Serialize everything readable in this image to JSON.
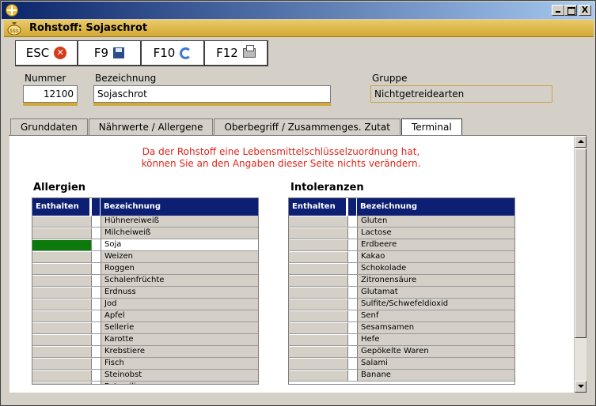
{
  "window": {
    "controls": {
      "minimize": "_",
      "maximize": "□",
      "close": "X"
    }
  },
  "header": {
    "title": "Rohstoff: Sojaschrot",
    "icon": "money-bag-icon"
  },
  "toolbar": [
    {
      "key": "ESC",
      "icon": "cancel-icon",
      "glyph": "✕"
    },
    {
      "key": "F9",
      "icon": "save-disk-icon"
    },
    {
      "key": "F10",
      "icon": "refresh-icon"
    },
    {
      "key": "F12",
      "icon": "printer-icon"
    }
  ],
  "fields": {
    "nummer": {
      "label": "Nummer",
      "value": "12100"
    },
    "bezeichnung": {
      "label": "Bezeichnung",
      "value": "Sojaschrot"
    },
    "gruppe": {
      "label": "Gruppe",
      "value": "Nichtgetreidearten"
    }
  },
  "tabs": [
    {
      "label": "Grunddaten",
      "active": false
    },
    {
      "label": "Nährwerte / Allergene",
      "active": false
    },
    {
      "label": "Oberbegriff / Zusammenges. Zutat",
      "active": false
    },
    {
      "label": "Terminal",
      "active": true
    }
  ],
  "notice": {
    "line1": "Da der Rohstoff eine Lebensmittelschlüsselzuordnung hat,",
    "line2": "können Sie an den Angaben dieser Seite nichts verändern."
  },
  "allergies": {
    "title": "Allergien",
    "col_contained": "Enthalten",
    "col_name": "Bezeichnung",
    "rows": [
      {
        "name": "Hühnereiweiß",
        "contained": false
      },
      {
        "name": "Milcheiweiß",
        "contained": false
      },
      {
        "name": "Soja",
        "contained": true
      },
      {
        "name": "Weizen",
        "contained": false
      },
      {
        "name": "Roggen",
        "contained": false
      },
      {
        "name": "Schalenfrüchte",
        "contained": false
      },
      {
        "name": "Erdnuss",
        "contained": false
      },
      {
        "name": "Jod",
        "contained": false
      },
      {
        "name": "Apfel",
        "contained": false
      },
      {
        "name": "Sellerie",
        "contained": false
      },
      {
        "name": "Karotte",
        "contained": false
      },
      {
        "name": "Krebstiere",
        "contained": false
      },
      {
        "name": "Fisch",
        "contained": false
      },
      {
        "name": "Steinobst",
        "contained": false
      },
      {
        "name": "Petersilie",
        "contained": false
      }
    ]
  },
  "intolerances": {
    "title": "Intoleranzen",
    "col_contained": "Enthalten",
    "col_name": "Bezeichnung",
    "rows": [
      {
        "name": "Gluten",
        "contained": false
      },
      {
        "name": "Lactose",
        "contained": false
      },
      {
        "name": "Erdbeere",
        "contained": false
      },
      {
        "name": "Kakao",
        "contained": false
      },
      {
        "name": "Schokolade",
        "contained": false
      },
      {
        "name": "Zitronensäure",
        "contained": false
      },
      {
        "name": "Glutamat",
        "contained": false
      },
      {
        "name": "Sulfite/Schwefeldioxid",
        "contained": false
      },
      {
        "name": "Senf",
        "contained": false
      },
      {
        "name": "Sesamsamen",
        "contained": false
      },
      {
        "name": "Hefe",
        "contained": false
      },
      {
        "name": "Gepökelte Waren",
        "contained": false
      },
      {
        "name": "Salami",
        "contained": false
      },
      {
        "name": "Banane",
        "contained": false
      }
    ]
  },
  "colors": {
    "header_gold": "#d9b23e",
    "grid_header": "#0c1f73",
    "contained_on": "#0b7a0b",
    "notice_red": "#e0261a"
  }
}
